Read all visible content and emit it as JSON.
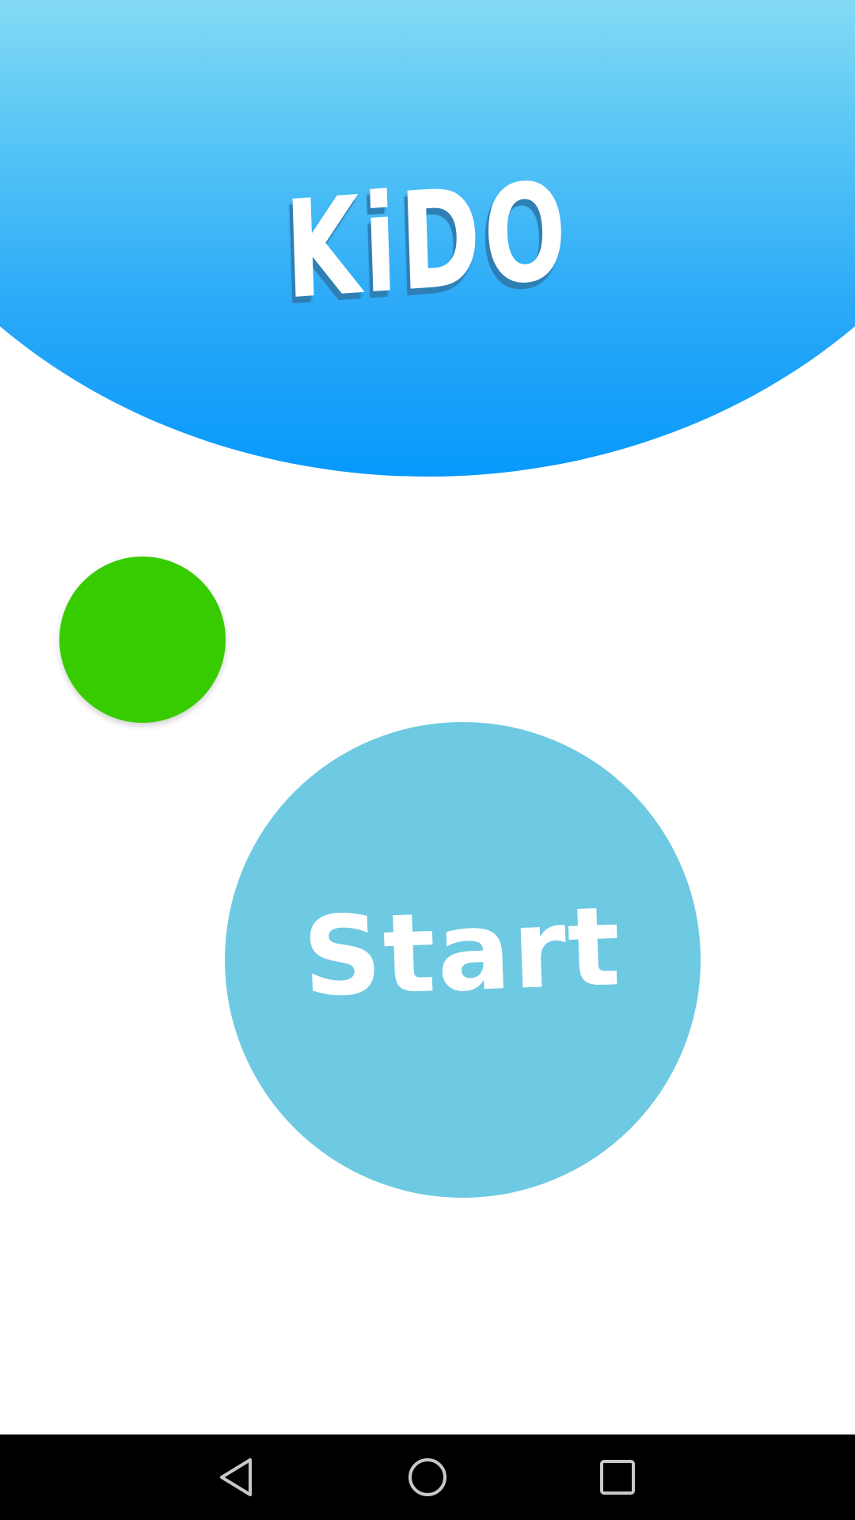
{
  "app": {
    "logo_text": "KiDO",
    "start_button_label": "Start"
  },
  "colors": {
    "header_top": "#88dcf5",
    "header_bottom": "#0799fb",
    "indicator": "#37cc00",
    "start_button": "#6ec9e2",
    "nav_bar": "#000000",
    "nav_icon": "#c8c8c8"
  },
  "nav_bar": {
    "buttons": [
      {
        "icon": "back-icon"
      },
      {
        "icon": "home-icon"
      },
      {
        "icon": "recents-icon"
      }
    ]
  }
}
